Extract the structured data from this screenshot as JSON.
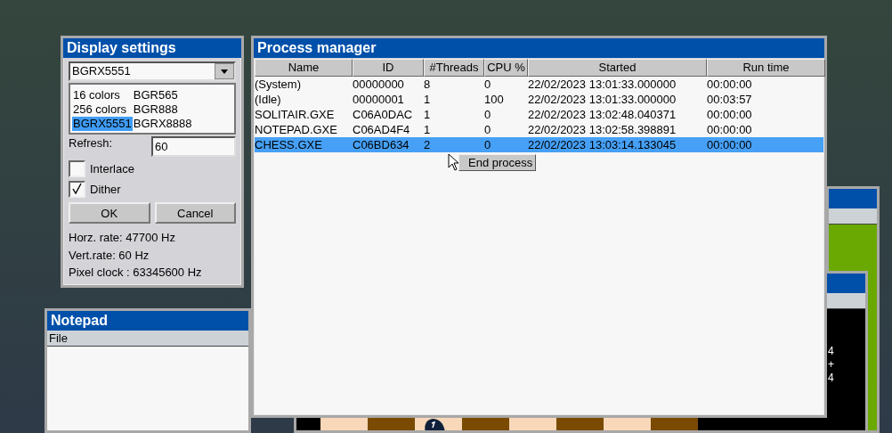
{
  "display_settings": {
    "title": "Display settings",
    "format_select": {
      "value": "BGRX5551"
    },
    "format_options": [
      {
        "label": "16 colors",
        "selected": false
      },
      {
        "label": "BGR565",
        "selected": false
      },
      {
        "label": "256 colors",
        "selected": false
      },
      {
        "label": "BGR888",
        "selected": false
      },
      {
        "label": "BGRX5551",
        "selected": true
      },
      {
        "label": "BGRX8888",
        "selected": false
      }
    ],
    "refresh": {
      "label": "Refresh:",
      "value": "60"
    },
    "checkboxes": [
      {
        "label": "Interlace",
        "checked": false
      },
      {
        "label": "Dither",
        "checked": true
      }
    ],
    "buttons": [
      "OK",
      "Cancel"
    ],
    "info": [
      "Horz. rate: 47700 Hz",
      "Vert.rate: 60 Hz",
      "Pixel clock : 63345600 Hz"
    ]
  },
  "process_manager": {
    "title": "Process manager",
    "columns": [
      "Name",
      "ID",
      "#Threads",
      "CPU %",
      "Started",
      "Run time"
    ],
    "rows": [
      {
        "cells": [
          "(System)",
          "00000000",
          "8",
          "0",
          "22/02/2023 13:01:33.000000",
          "00:00:00"
        ],
        "selected": false
      },
      {
        "cells": [
          "(Idle)",
          "00000001",
          "1",
          "100",
          "22/02/2023 13:01:33.000000",
          "00:03:57"
        ],
        "selected": false
      },
      {
        "cells": [
          "SOLITAIR.GXE",
          "C06A0DAC",
          "1",
          "0",
          "22/02/2023 13:02:48.040371",
          "00:00:00"
        ],
        "selected": false
      },
      {
        "cells": [
          "NOTEPAD.GXE",
          "C06AD4F4",
          "1",
          "0",
          "22/02/2023 13:02:58.398891",
          "00:00:00"
        ],
        "selected": false
      },
      {
        "cells": [
          "CHESS.GXE",
          "C06BD634",
          "2",
          "0",
          "22/02/2023 13:03:14.133045",
          "00:00:00"
        ],
        "selected": true
      }
    ],
    "context_menu": {
      "items": [
        "End process"
      ]
    }
  },
  "notepad": {
    "title": "Notepad",
    "menu": [
      "File"
    ]
  },
  "chess": {
    "notes": [
      "4",
      "+",
      "4"
    ]
  }
}
